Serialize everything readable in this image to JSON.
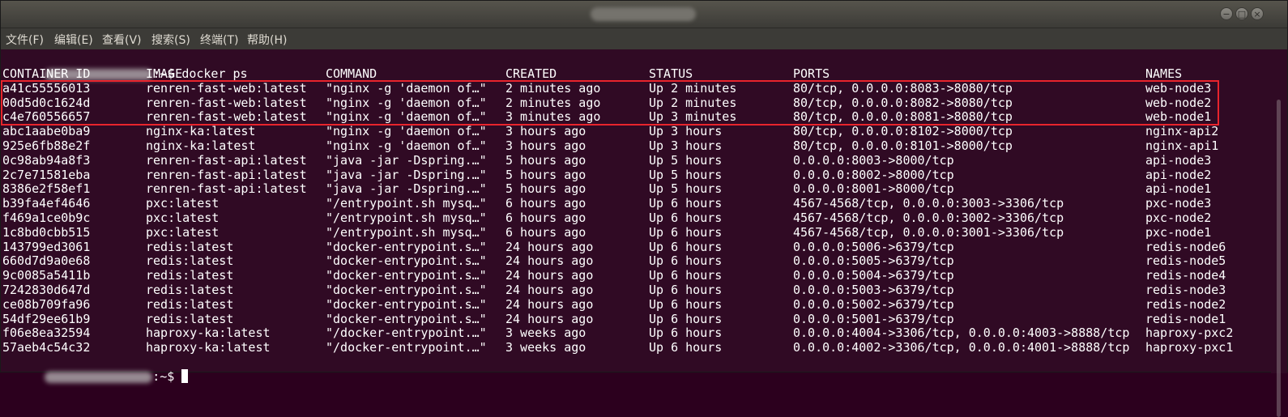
{
  "window": {
    "close_symbol": "×",
    "maximize_symbol": "□",
    "minimize_symbol": "−"
  },
  "menu": [
    "文件(F)",
    "编辑(E)",
    "查看(V)",
    "搜索(S)",
    "终端(T)",
    "帮助(H)"
  ],
  "prompt": {
    "suffix": ":~$ ",
    "command": "docker ps"
  },
  "headers": [
    "CONTAINER ID",
    "IMAGE",
    "COMMAND",
    "CREATED",
    "STATUS",
    "PORTS",
    "NAMES"
  ],
  "rows": [
    [
      "a41c55556013",
      "renren-fast-web:latest",
      "\"nginx -g 'daemon of…\"",
      "2 minutes ago",
      "Up 2 minutes",
      "80/tcp, 0.0.0.0:8083->8080/tcp",
      "web-node3"
    ],
    [
      "00d5d0c1624d",
      "renren-fast-web:latest",
      "\"nginx -g 'daemon of…\"",
      "2 minutes ago",
      "Up 2 minutes",
      "80/tcp, 0.0.0.0:8082->8080/tcp",
      "web-node2"
    ],
    [
      "c4e760556657",
      "renren-fast-web:latest",
      "\"nginx -g 'daemon of…\"",
      "3 minutes ago",
      "Up 3 minutes",
      "80/tcp, 0.0.0.0:8081->8080/tcp",
      "web-node1"
    ],
    [
      "abc1aabe0ba9",
      "nginx-ka:latest",
      "\"nginx -g 'daemon of…\"",
      "3 hours ago",
      "Up 3 hours",
      "80/tcp, 0.0.0.0:8102->8000/tcp",
      "nginx-api2"
    ],
    [
      "925e6fb88e2f",
      "nginx-ka:latest",
      "\"nginx -g 'daemon of…\"",
      "3 hours ago",
      "Up 3 hours",
      "80/tcp, 0.0.0.0:8101->8000/tcp",
      "nginx-api1"
    ],
    [
      "0c98ab94a8f3",
      "renren-fast-api:latest",
      "\"java -jar -Dspring.…\"",
      "5 hours ago",
      "Up 5 hours",
      "0.0.0.0:8003->8000/tcp",
      "api-node3"
    ],
    [
      "2c7e71581eba",
      "renren-fast-api:latest",
      "\"java -jar -Dspring.…\"",
      "5 hours ago",
      "Up 5 hours",
      "0.0.0.0:8002->8000/tcp",
      "api-node2"
    ],
    [
      "8386e2f58ef1",
      "renren-fast-api:latest",
      "\"java -jar -Dspring.…\"",
      "5 hours ago",
      "Up 5 hours",
      "0.0.0.0:8001->8000/tcp",
      "api-node1"
    ],
    [
      "b39fa4ef4646",
      "pxc:latest",
      "\"/entrypoint.sh mysq…\"",
      "6 hours ago",
      "Up 6 hours",
      "4567-4568/tcp, 0.0.0.0:3003->3306/tcp",
      "pxc-node3"
    ],
    [
      "f469a1ce0b9c",
      "pxc:latest",
      "\"/entrypoint.sh mysq…\"",
      "6 hours ago",
      "Up 6 hours",
      "4567-4568/tcp, 0.0.0.0:3002->3306/tcp",
      "pxc-node2"
    ],
    [
      "1c8bd0cbb515",
      "pxc:latest",
      "\"/entrypoint.sh mysq…\"",
      "6 hours ago",
      "Up 6 hours",
      "4567-4568/tcp, 0.0.0.0:3001->3306/tcp",
      "pxc-node1"
    ],
    [
      "143799ed3061",
      "redis:latest",
      "\"docker-entrypoint.s…\"",
      "24 hours ago",
      "Up 6 hours",
      "0.0.0.0:5006->6379/tcp",
      "redis-node6"
    ],
    [
      "660d7d9a0e68",
      "redis:latest",
      "\"docker-entrypoint.s…\"",
      "24 hours ago",
      "Up 6 hours",
      "0.0.0.0:5005->6379/tcp",
      "redis-node5"
    ],
    [
      "9c0085a5411b",
      "redis:latest",
      "\"docker-entrypoint.s…\"",
      "24 hours ago",
      "Up 6 hours",
      "0.0.0.0:5004->6379/tcp",
      "redis-node4"
    ],
    [
      "7242830d647d",
      "redis:latest",
      "\"docker-entrypoint.s…\"",
      "24 hours ago",
      "Up 6 hours",
      "0.0.0.0:5003->6379/tcp",
      "redis-node3"
    ],
    [
      "ce08b709fa96",
      "redis:latest",
      "\"docker-entrypoint.s…\"",
      "24 hours ago",
      "Up 6 hours",
      "0.0.0.0:5002->6379/tcp",
      "redis-node2"
    ],
    [
      "54df29ee61b9",
      "redis:latest",
      "\"docker-entrypoint.s…\"",
      "24 hours ago",
      "Up 6 hours",
      "0.0.0.0:5001->6379/tcp",
      "redis-node1"
    ],
    [
      "f06e8ea32594",
      "haproxy-ka:latest",
      "\"/docker-entrypoint.…\"",
      "3 weeks ago",
      "Up 6 hours",
      "0.0.0.0:4004->3306/tcp, 0.0.0.0:4003->8888/tcp",
      "haproxy-pxc2"
    ],
    [
      "57aeb4c54c32",
      "haproxy-ka:latest",
      "\"/docker-entrypoint.…\"",
      "3 weeks ago",
      "Up 6 hours",
      "0.0.0.0:4002->3306/tcp, 0.0.0.0:4001->8888/tcp",
      "haproxy-pxc1"
    ]
  ],
  "colors": {
    "terminal_bg": "#300a24",
    "text": "#ffffff",
    "highlight_border": "#e8242c",
    "menubar_bg": "#3c3b37"
  }
}
